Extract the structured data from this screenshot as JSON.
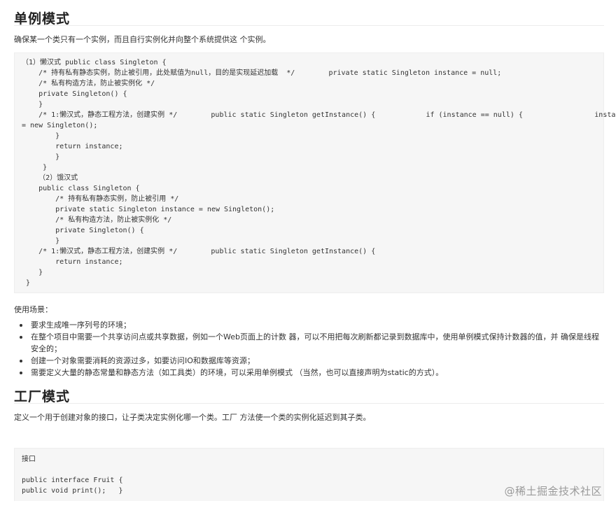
{
  "singleton": {
    "title": "单例模式",
    "intro": "确保某一个类只有一个实例，而且自行实例化并向整个系统提供这 个实例。",
    "code_lines": [
      "（1）懒汉式 public class Singleton {",
      "    /* 持有私有静态实例，防止被引用，此处赋值为null，目的是实现延迟加载  */        private static Singleton instance = null;",
      "    /* 私有构造方法，防止被实例化 */",
      "    private Singleton() {",
      "    }",
      "    /* 1:懒汉式，静态工程方法，创建实例 */        public static Singleton getInstance() {            if (instance == null) {                 instance",
      "= new Singleton();",
      "        }",
      "        return instance;",
      "        }",
      "     }",
      "    （2）饿汉式",
      "    public class Singleton {",
      "        /* 持有私有静态实例，防止被引用 */",
      "        private static Singleton instance = new Singleton();",
      "        /* 私有构造方法，防止被实例化 */",
      "        private Singleton() {",
      "        }",
      "    /* 1:懒汉式，静态工程方法，创建实例 */        public static Singleton getInstance() {",
      "        return instance;",
      "    }",
      " }"
    ],
    "usage_title": "使用场景：",
    "usage_items": [
      "要求生成唯一序列号的环境；",
      "在整个项目中需要一个共享访问点或共享数据，例如一个Web页面上的计数 器，可以不用把每次刷新都记录到数据库中，使用单例模式保持计数器的值，并 确保是线程安全的；",
      "创建一个对象需要消耗的资源过多，如要访问IO和数据库等资源；",
      "需要定义大量的静态常量和静态方法（如工具类）的环境，可以采用单例模式 （当然，也可以直接声明为static的方式）。"
    ]
  },
  "factory": {
    "title": "工厂模式",
    "intro": "定义一个用于创建对象的接口，让子类决定实例化哪一个类。工厂 方法使一个类的实例化延迟到其子类。",
    "code_lines": [
      "接口",
      "",
      "public interface Fruit {",
      "public void print();   }"
    ]
  },
  "watermark": "@稀土掘金技术社区"
}
